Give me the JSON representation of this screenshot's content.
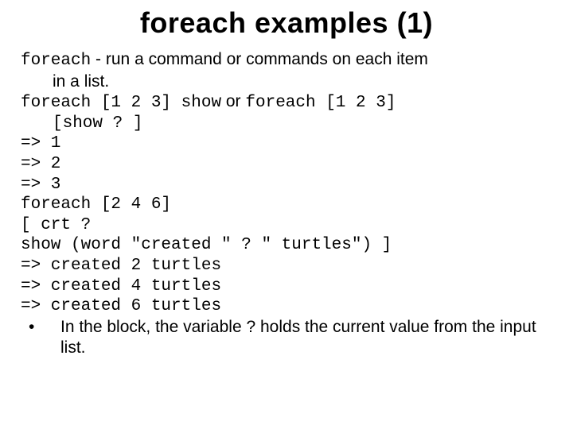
{
  "title": "foreach examples (1)",
  "desc": {
    "keyword": "foreach",
    "rest_line1": " - run a command or commands on each item",
    "line2": "in a list."
  },
  "code": {
    "l1a": "foreach [1 2 3] show",
    "l1mid": " or ",
    "l1b": "foreach [1 2 3]",
    "l2": "[show ? ]",
    "l3": "=> 1",
    "l4": "=> 2",
    "l5": "=> 3",
    "l6": "foreach [2 4 6]",
    "l7": "[ crt ?",
    "l8": "show (word \"created \" ? \" turtles\") ]",
    "l9": "=> created 2 turtles",
    "l10": "=> created 4 turtles",
    "l11": "=> created 6 turtles"
  },
  "bullet": {
    "dot": "•",
    "text": "In the block, the variable ? holds the current value from the input list."
  }
}
